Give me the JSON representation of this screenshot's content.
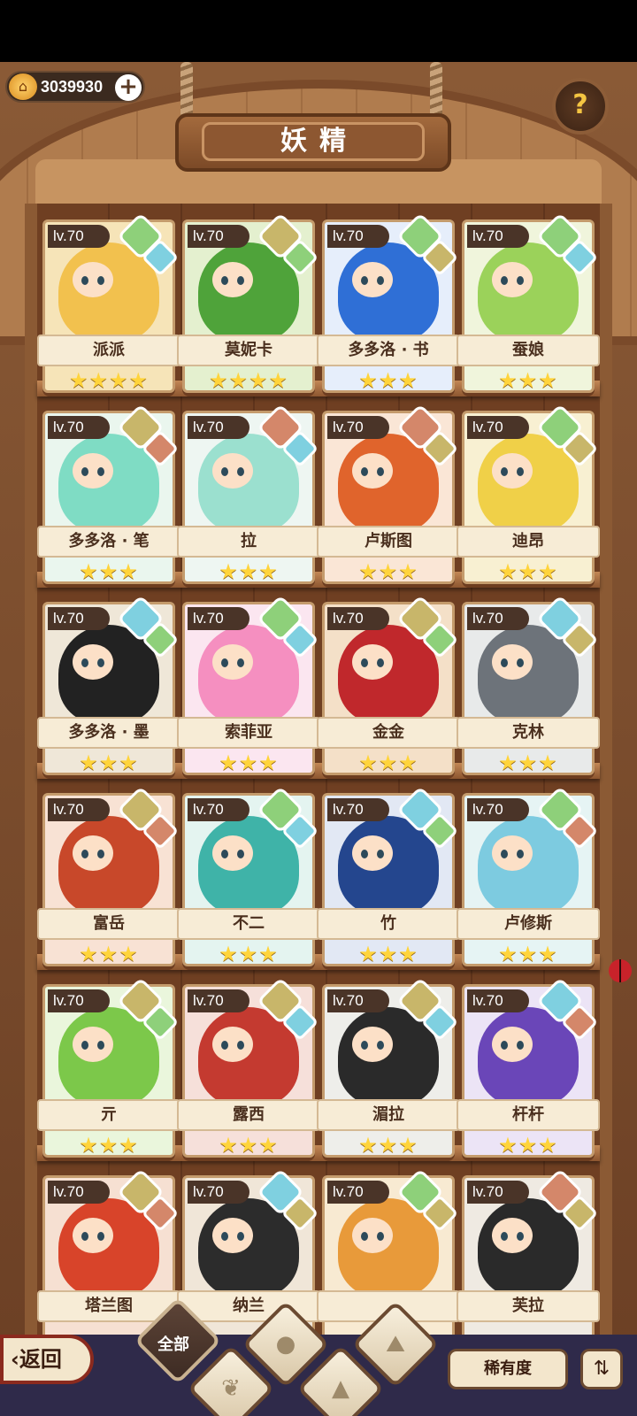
{
  "currency": {
    "amount": "3039930",
    "coin_icon": "coin-house-icon",
    "add_icon": "plus-icon"
  },
  "help": {
    "icon": "question-icon",
    "label": "?"
  },
  "title": "妖精",
  "cards": [
    {
      "level": "lv.70",
      "name": "派派",
      "stars": "★★★★",
      "hair": "#f2c14e",
      "bg": "#f6e4b8",
      "b1": "#8ed07a",
      "b2": "#7fd0e0"
    },
    {
      "level": "lv.70",
      "name": "莫妮卡",
      "stars": "★★★★",
      "hair": "#4fa33a",
      "bg": "#e4f0cf",
      "b1": "#c8b66a",
      "b2": "#8ed07a"
    },
    {
      "level": "lv.70",
      "name": "多多洛 · 书",
      "stars": "★★★",
      "hair": "#2f6fd6",
      "bg": "#e6eefb",
      "b1": "#8ed07a",
      "b2": "#c8b66a"
    },
    {
      "level": "lv.70",
      "name": "蚕娘",
      "stars": "★★★",
      "hair": "#9bd25a",
      "bg": "#f0f5dc",
      "b1": "#8ed07a",
      "b2": "#7fd0e0"
    },
    {
      "level": "lv.70",
      "name": "多多洛 · 笔",
      "stars": "★★★",
      "hair": "#7fdcc4",
      "bg": "#eaf6ee",
      "b1": "#c8b66a",
      "b2": "#d4876a"
    },
    {
      "level": "lv.70",
      "name": "拉",
      "stars": "★★★",
      "hair": "#9be0cf",
      "bg": "#eef6f2",
      "b1": "#d4876a",
      "b2": "#7fd0e0"
    },
    {
      "level": "lv.70",
      "name": "卢斯图",
      "stars": "★★★",
      "hair": "#e0642c",
      "bg": "#fae6d6",
      "b1": "#d4876a",
      "b2": "#c8b66a"
    },
    {
      "level": "lv.70",
      "name": "迪昂",
      "stars": "★★★",
      "hair": "#f0d048",
      "bg": "#f8f0d2",
      "b1": "#8ed07a",
      "b2": "#c8b66a"
    },
    {
      "level": "lv.70",
      "name": "多多洛 · 墨",
      "stars": "★★★",
      "hair": "#222222",
      "bg": "#efe7d8",
      "b1": "#7fd0e0",
      "b2": "#8ed07a"
    },
    {
      "level": "lv.70",
      "name": "索菲亚",
      "stars": "★★★",
      "hair": "#f58fc0",
      "bg": "#fbe6f0",
      "b1": "#8ed07a",
      "b2": "#7fd0e0"
    },
    {
      "level": "lv.70",
      "name": "金金",
      "stars": "★★★",
      "hair": "#c0282c",
      "bg": "#f4e0c8",
      "b1": "#c8b66a",
      "b2": "#8ed07a"
    },
    {
      "level": "lv.70",
      "name": "克林",
      "stars": "★★★",
      "hair": "#6d737a",
      "bg": "#e8eaea",
      "b1": "#7fd0e0",
      "b2": "#c8b66a"
    },
    {
      "level": "lv.70",
      "name": "富岳",
      "stars": "★★★",
      "hair": "#c8482a",
      "bg": "#f8e2d4",
      "b1": "#c8b66a",
      "b2": "#d4876a"
    },
    {
      "level": "lv.70",
      "name": "不二",
      "stars": "★★★",
      "hair": "#3fb3a8",
      "bg": "#e4f4f0",
      "b1": "#8ed07a",
      "b2": "#7fd0e0"
    },
    {
      "level": "lv.70",
      "name": "竹",
      "stars": "★★★",
      "hair": "#24468e",
      "bg": "#e2e8f4",
      "b1": "#7fd0e0",
      "b2": "#8ed07a"
    },
    {
      "level": "lv.70",
      "name": "卢修斯",
      "stars": "★★★",
      "hair": "#7dcbe0",
      "bg": "#e6f4f4",
      "b1": "#8ed07a",
      "b2": "#d4876a"
    },
    {
      "level": "lv.70",
      "name": "亓",
      "stars": "★★★",
      "hair": "#7cc84a",
      "bg": "#eaf6dc",
      "b1": "#c8b66a",
      "b2": "#8ed07a"
    },
    {
      "level": "lv.70",
      "name": "露西",
      "stars": "★★★",
      "hair": "#c43a30",
      "bg": "#f6e0da",
      "b1": "#c8b66a",
      "b2": "#7fd0e0"
    },
    {
      "level": "lv.70",
      "name": "湄拉",
      "stars": "★★★",
      "hair": "#2a2a2a",
      "bg": "#eeeeea",
      "b1": "#c8b66a",
      "b2": "#7fd0e0"
    },
    {
      "level": "lv.70",
      "name": "杆杆",
      "stars": "★★★",
      "hair": "#6a46b8",
      "bg": "#ece4f6",
      "b1": "#7fd0e0",
      "b2": "#d4876a"
    },
    {
      "level": "lv.70",
      "name": "塔兰图",
      "stars": "",
      "hair": "#d8442a",
      "bg": "#f6e0d2",
      "b1": "#c8b66a",
      "b2": "#d4876a"
    },
    {
      "level": "lv.70",
      "name": "纳兰",
      "stars": "",
      "hair": "#2c2c2c",
      "bg": "#f0e6d8",
      "b1": "#7fd0e0",
      "b2": "#c8b66a"
    },
    {
      "level": "lv.70",
      "name": "",
      "stars": "",
      "hair": "#e89a3a",
      "bg": "#f8ead2",
      "b1": "#8ed07a",
      "b2": "#c8b66a"
    },
    {
      "level": "lv.70",
      "name": "芙拉",
      "stars": "",
      "hair": "#2a2a2a",
      "bg": "#efeae2",
      "b1": "#d4876a",
      "b2": "#c8b66a"
    }
  ],
  "bottom": {
    "back_label": "返回",
    "filter_all_label": "全部",
    "sort_label": "稀有度",
    "order_icon": "sort-order-icon"
  }
}
